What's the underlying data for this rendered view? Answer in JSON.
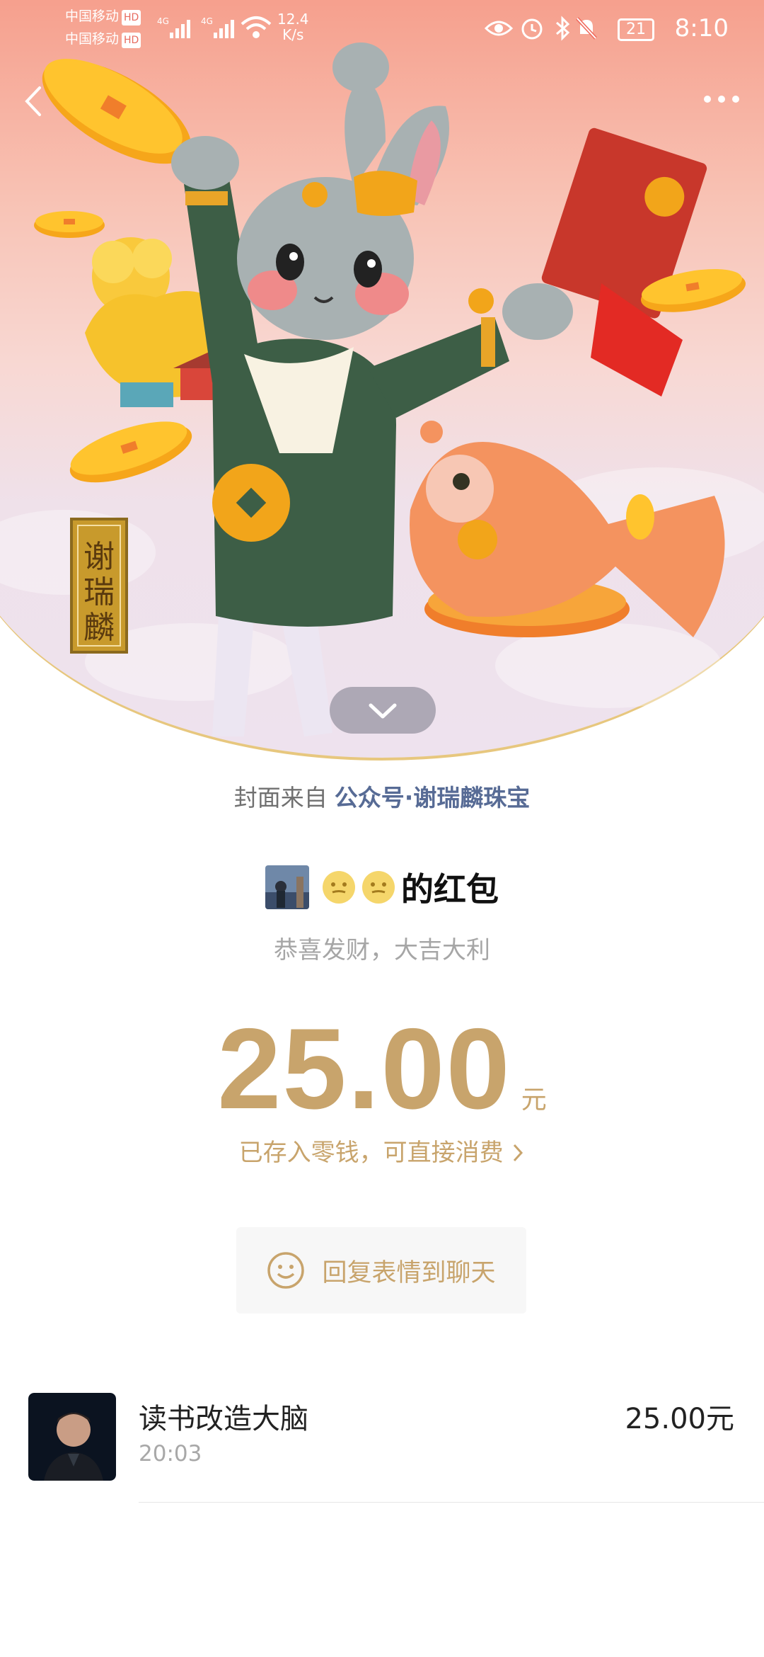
{
  "status_bar": {
    "carrier1": "中国移动",
    "carrier2": "中国移动",
    "hd": "HD",
    "network": "4G",
    "speed_value": "12.4",
    "speed_unit": "K/s",
    "battery": "21",
    "time": "8:10"
  },
  "cover": {
    "brand_seal": "谢瑞麟",
    "source_prefix": "封面来自",
    "source_account": "公众号·谢瑞麟珠宝"
  },
  "packet": {
    "sender_suffix": "的红包",
    "greeting": "恭喜发财，大吉大利",
    "amount": "25.00",
    "unit": "元",
    "deposit_text": "已存入零钱，可直接消费",
    "reply_label": "回复表情到聊天"
  },
  "record": {
    "name": "读书改造大脑",
    "time": "20:03",
    "amount": "25.00元"
  },
  "colors": {
    "accent_gold": "#c8a46c",
    "link_blue": "#576b95",
    "red_gradient_top": "#f0625a"
  }
}
